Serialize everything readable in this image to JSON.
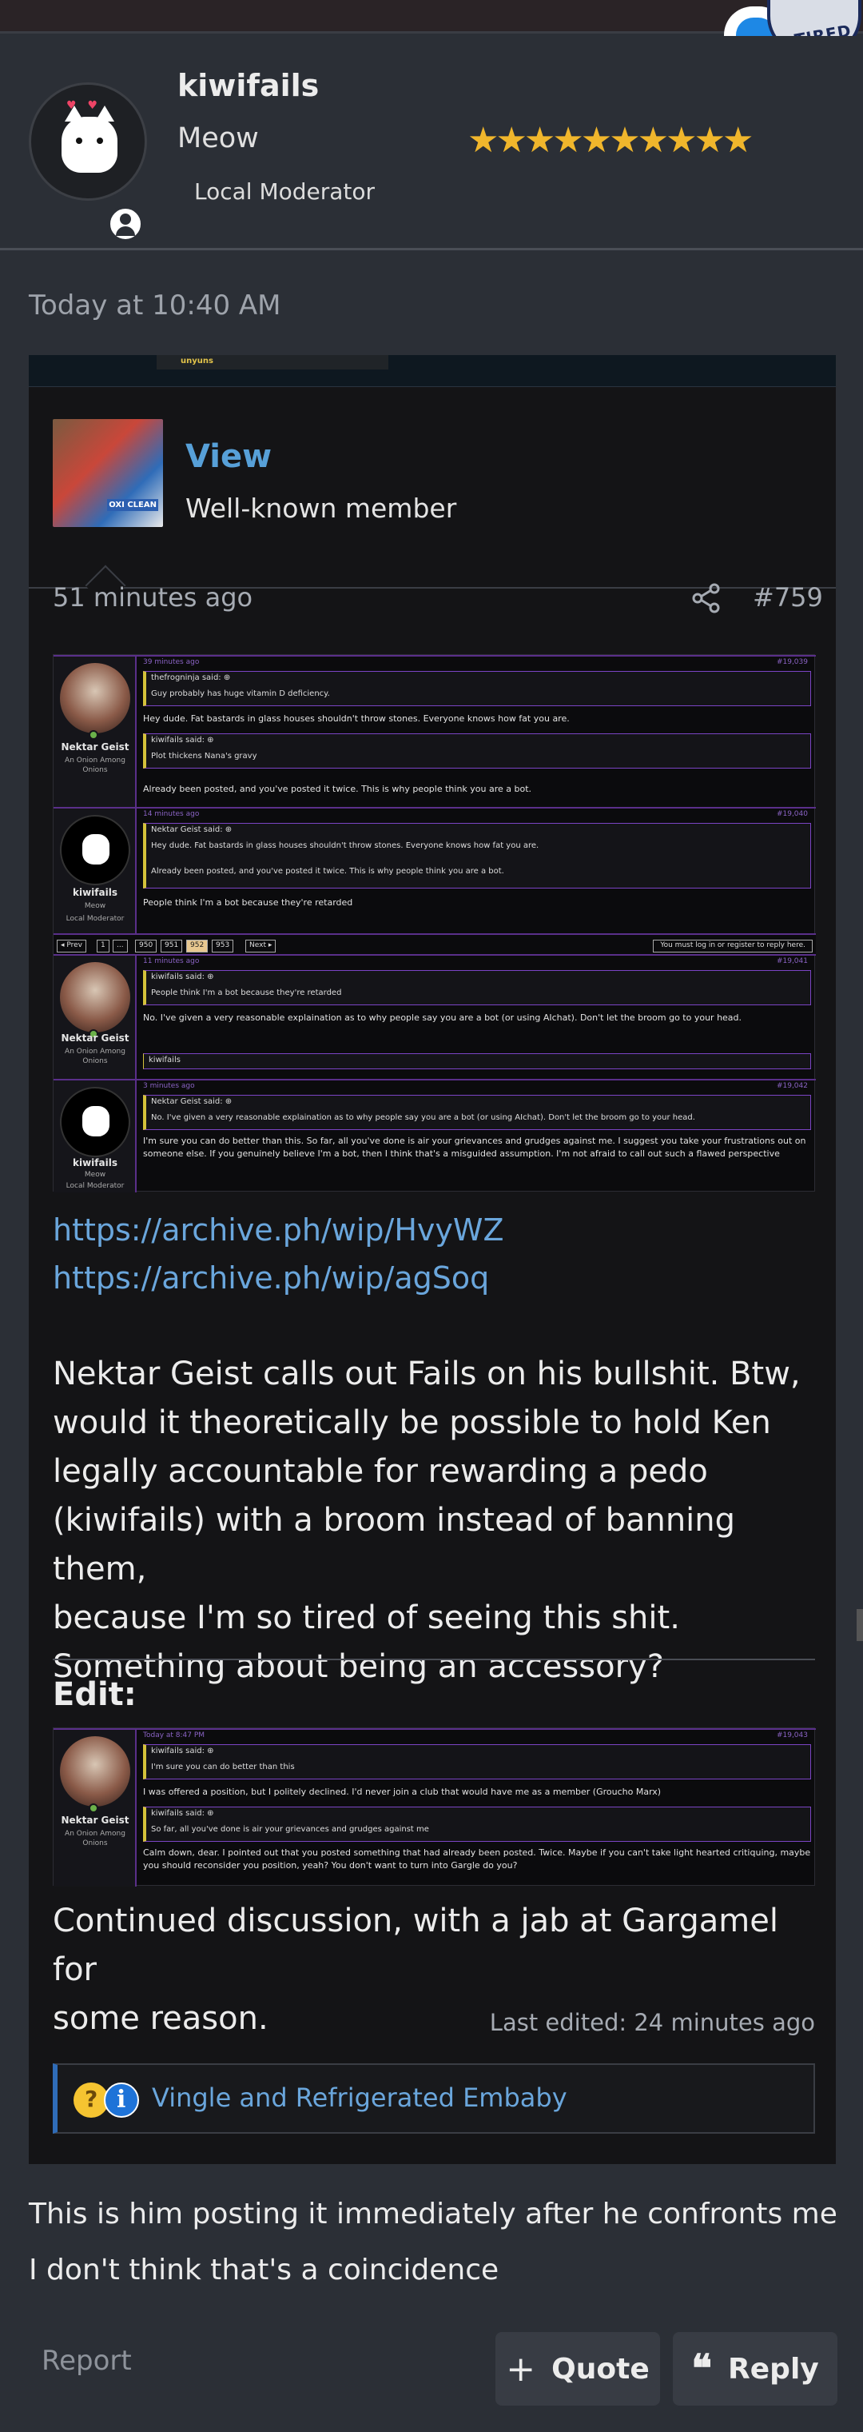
{
  "header_badge": {
    "text": "TIRED"
  },
  "post": {
    "username": "kiwifails",
    "user_title": "Meow",
    "role": "Local Moderator",
    "stars": "★★★★★★★★★★",
    "time": "Today at 10:40 AM"
  },
  "quote": {
    "top_tab": "unyuns",
    "username": "View",
    "user_title": "Well-known member",
    "time_ago": "51 minutes ago",
    "post_number": "#759",
    "screenshot1": {
      "rows": [
        {
          "meta": "39 minutes ago",
          "num": "#19,039",
          "name": "Nektar Geist",
          "sub": "An Onion Among Onions",
          "q1_head": "thefrogninja said: ⊕",
          "q1_text": "Guy probably has huge vitamin D deficiency.",
          "text1": "Hey dude. Fat bastards in glass houses shouldn't throw stones. Everyone knows how fat you are.",
          "q2_head": "kiwifails said: ⊕",
          "q2_text": "Plot thickens Nana's gravy",
          "text2": "Already been posted, and you've posted it twice. This is why people think you are a bot."
        },
        {
          "meta": "14 minutes ago",
          "num": "#19,040",
          "name": "kiwifails",
          "sub": "Meow",
          "role": "Local Moderator",
          "q1_head": "Nektar Geist said: ⊕",
          "q1_text": "Hey dude. Fat bastards in glass houses shouldn't throw stones. Everyone knows how fat you are.",
          "q1_text2": "Already been posted, and you've posted it twice. This is why people think you are a bot.",
          "text1": "People think I'm a bot because they're retarded"
        },
        {
          "meta": "11 minutes ago",
          "num": "#19,041",
          "name": "Nektar Geist",
          "sub": "An Onion Among Onions",
          "q1_head": "kiwifails said: ⊕",
          "q1_text": "People think I'm a bot because they're retarded",
          "text1": "No. I've given a very reasonable explaination as to why people say you are a bot (or using AIchat). Don't let the broom go to your head.",
          "react": "kiwifails"
        },
        {
          "meta": "3 minutes ago",
          "num": "#19,042",
          "name": "kiwifails",
          "sub": "Meow",
          "role": "Local Moderator",
          "q1_head": "Nektar Geist said: ⊕",
          "q1_text": "No. I've given a very reasonable explaination as to why people say you are a bot (or using AIchat). Don't let the broom go to your head.",
          "text1": "I'm sure you can do better than this. So far, all you've done is air your grievances and grudges against me. I suggest you take your frustrations out on someone else. If you genuinely believe I'm a bot, then I think that's a misguided assumption. I'm not afraid to call out such a flawed perspective"
        }
      ],
      "pager": [
        "◂ Prev",
        "1",
        "...",
        "950",
        "951",
        "952",
        "953",
        "Next ▸"
      ],
      "pager_current": "952",
      "login_text": "You must log in or register to reply here."
    },
    "links": [
      "https://archive.ph/wip/HvyWZ",
      "https://archive.ph/wip/agSoq"
    ],
    "body_lines": [
      "Nektar Geist calls out Fails on his bullshit. Btw,",
      "would it theoretically be possible to hold Ken",
      "legally accountable for rewarding a pedo",
      "(kiwifails) with a broom instead of banning them,",
      "because I'm so tired of seeing this shit.",
      "Something about being an accessory?"
    ],
    "edit_label": "Edit:",
    "screenshot2": {
      "meta": "Today at 8:47 PM",
      "num": "#19,043",
      "name": "Nektar Geist",
      "sub": "An Onion Among Onions",
      "q1_head": "kiwifails said: ⊕",
      "q1_text": "I'm sure you can do better than this",
      "text1": "I was offered a position, but I politely declined. I'd never join a club that would have me as a member (Groucho Marx)",
      "q2_head": "kiwifails said: ⊕",
      "q2_text": "So far, all you've done is air your grievances and grudges against me",
      "text2": "Calm down, dear. I pointed out that you posted something that had already been posted. Twice. Maybe if you can't take light hearted critiquing, maybe you should reconsider you position, yeah? You don't want to turn into Gargle do you?"
    },
    "body2_lines": [
      "Continued discussion, with a jab at Gargamel for",
      "some reason."
    ],
    "last_edited": "Last edited: 24 minutes ago",
    "reactions_text": "Vingle and Refrigerated Embaby"
  },
  "reply_lines": [
    "This is him posting it immediately after he confronts me",
    "I don't think that's a coincidence"
  ],
  "actions": {
    "report": "Report",
    "quote": "Quote",
    "reply": "Reply"
  },
  "colors": {
    "link": "#6aa6dc",
    "star": "#f0b62c",
    "accent": "#2f6cb8"
  }
}
